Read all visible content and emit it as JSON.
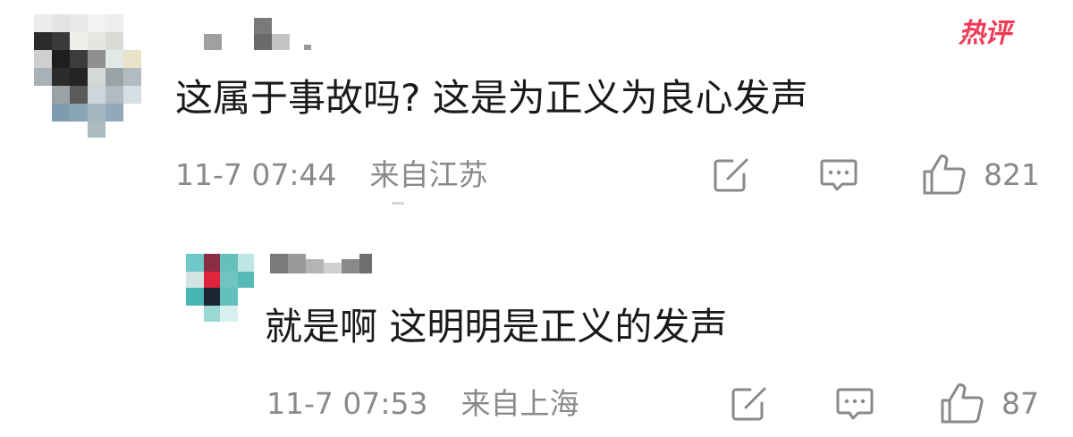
{
  "badge": {
    "label": "热评"
  },
  "comments": [
    {
      "text": "这属于事故吗? 这是为正义为良心发声",
      "time": "11-7 07:44",
      "location": "来自江苏",
      "likes": "821"
    },
    {
      "text": "就是啊 这明明是正义的发声",
      "time": "11-7 07:53",
      "location": "来自上海",
      "likes": "87"
    }
  ],
  "icons": {
    "share": "share-edit-icon",
    "comment": "comment-icon",
    "like": "thumbs-up-icon"
  },
  "colors": {
    "badge": "#f03b56",
    "text": "#1a1a1a",
    "meta": "#8a8a8a"
  }
}
